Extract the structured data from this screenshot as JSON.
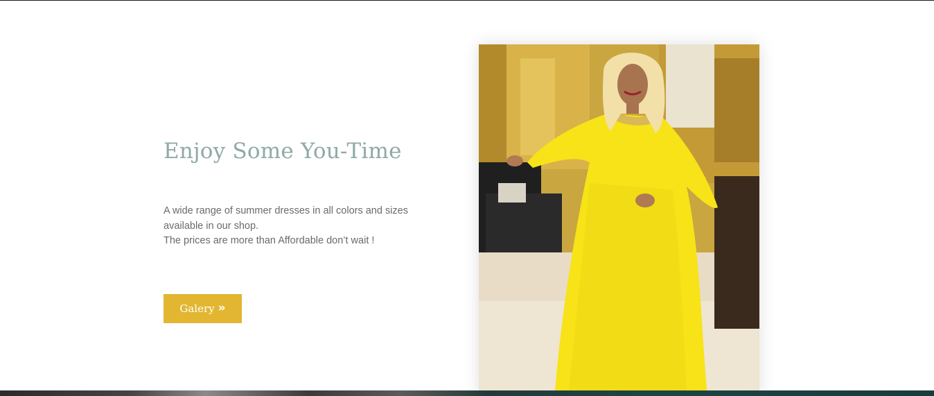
{
  "hero": {
    "heading": "Enjoy Some You-Time",
    "description_lines": [
      "A wide range of summer dresses in all colors and sizes",
      "available in our shop.",
      "The prices are more than Affordable don’t wait !"
    ],
    "button": {
      "label": "Galery",
      "icon": "double-chevron-right-icon"
    }
  },
  "colors": {
    "heading": "#8fa9a7",
    "body_text": "#6a6a6a",
    "button_bg": "#e2b631",
    "button_text": "#ffffff",
    "dress": "#f7e317"
  }
}
